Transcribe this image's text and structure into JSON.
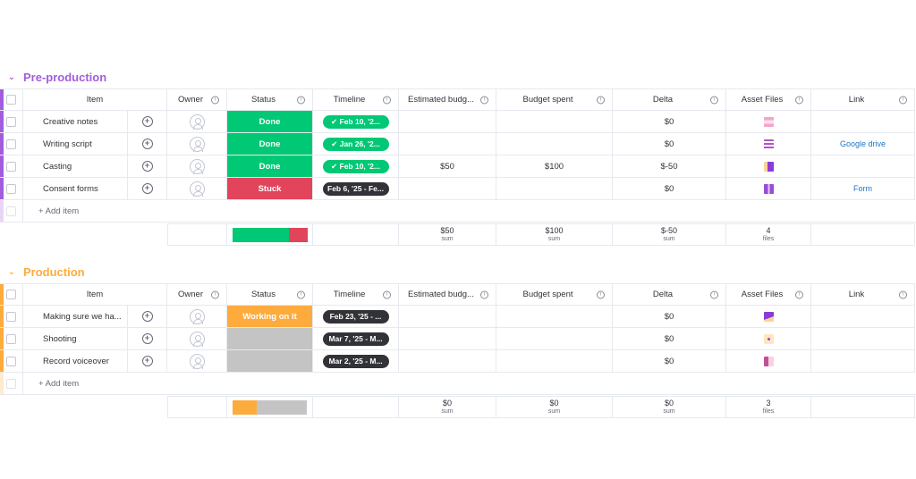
{
  "columns": {
    "item": "Item",
    "owner": "Owner",
    "status": "Status",
    "timeline": "Timeline",
    "estimated_budget": "Estimated budg...",
    "budget_spent": "Budget spent",
    "delta": "Delta",
    "asset_files": "Asset Files",
    "link": "Link"
  },
  "add_item_label": "+ Add item",
  "groups": [
    {
      "title": "Pre-production",
      "color": "#a25ddc",
      "rows": [
        {
          "item": "Creative notes",
          "status": "Done",
          "status_color": "#00c875",
          "timeline": "✔ Feb 10, '2...",
          "timeline_color": "#00c875",
          "estimated_budget": "",
          "budget_spent": "",
          "delta": "$0",
          "file_icon": "pink-doc-file-icon",
          "link": ""
        },
        {
          "item": "Writing script",
          "status": "Done",
          "status_color": "#00c875",
          "timeline": "✔ Jan 26, '2...",
          "timeline_color": "#00c875",
          "estimated_budget": "",
          "budget_spent": "",
          "delta": "$0",
          "file_icon": "purple-lines-file-icon",
          "link": "Google drive"
        },
        {
          "item": "Casting",
          "status": "Done",
          "status_color": "#00c875",
          "timeline": "✔ Feb 10, '2...",
          "timeline_color": "#00c875",
          "estimated_budget": "$50",
          "budget_spent": "$100",
          "delta": "$-50",
          "file_icon": "purple-image-file-icon",
          "link": ""
        },
        {
          "item": "Consent forms",
          "status": "Stuck",
          "status_color": "#e2445c",
          "timeline": "Feb 6, '25 - Fe...",
          "timeline_color": "#323338",
          "estimated_budget": "",
          "budget_spent": "",
          "delta": "$0",
          "file_icon": "purple-film-file-icon",
          "link": "Form"
        }
      ],
      "summary": {
        "status_distribution": [
          {
            "label": "Done",
            "fraction": 0.75,
            "color": "#00c875"
          },
          {
            "label": "Stuck",
            "fraction": 0.25,
            "color": "#e2445c"
          }
        ],
        "estimated_budget": "$50",
        "budget_spent": "$100",
        "delta": "$-50",
        "sum_label": "sum",
        "files_count": "4",
        "files_label": "files"
      }
    },
    {
      "title": "Production",
      "color": "#fdab3d",
      "rows": [
        {
          "item": "Making sure we ha...",
          "status": "Working on it",
          "status_color": "#fdab3d",
          "timeline": "Feb 23, '25 - ...",
          "timeline_color": "#323338",
          "estimated_budget": "",
          "budget_spent": "",
          "delta": "$0",
          "file_icon": "purple-chart-file-icon",
          "link": ""
        },
        {
          "item": "Shooting",
          "status": "",
          "status_color": "#c4c4c4",
          "timeline": "Mar 7, '25 - M...",
          "timeline_color": "#323338",
          "estimated_budget": "",
          "budget_spent": "",
          "delta": "$0",
          "file_icon": "yellow-dot-file-icon",
          "link": ""
        },
        {
          "item": "Record voiceover",
          "status": "",
          "status_color": "#c4c4c4",
          "timeline": "Mar 2, '25 - M...",
          "timeline_color": "#323338",
          "estimated_budget": "",
          "budget_spent": "",
          "delta": "$0",
          "file_icon": "pink-toggle-file-icon",
          "link": ""
        }
      ],
      "summary": {
        "status_distribution": [
          {
            "label": "Working on it",
            "fraction": 0.33,
            "color": "#fdab3d"
          },
          {
            "label": "Empty",
            "fraction": 0.67,
            "color": "#c4c4c4"
          }
        ],
        "estimated_budget": "$0",
        "budget_spent": "$0",
        "delta": "$0",
        "sum_label": "sum",
        "files_count": "3",
        "files_label": "files"
      }
    }
  ]
}
